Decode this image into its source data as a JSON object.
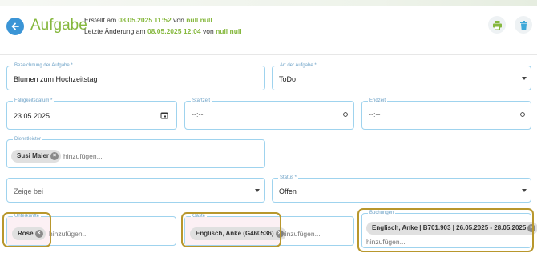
{
  "header": {
    "title": "Aufgabe",
    "created_label": "Erstellt am",
    "created_date": "08.05.2025 11:52",
    "created_by_label": "von",
    "created_by": "null null",
    "changed_label": "Letzte Änderung am",
    "changed_date": "08.05.2025 12:04",
    "changed_by_label": "von",
    "changed_by": "null null",
    "icons": {
      "back": "arrow-left-icon",
      "print": "printer-icon",
      "delete": "trash-icon"
    }
  },
  "form": {
    "bezeichnung": {
      "label": "Bezeichnung der Aufgabe *",
      "value": "Blumen zum Hochzeitstag"
    },
    "art": {
      "label": "Art der Aufgabe *",
      "value": "ToDo"
    },
    "faelligkeit": {
      "label": "Fälligkeitsdatum *",
      "value": "23.05.2025"
    },
    "startzeit": {
      "label": "Startzeit",
      "value": "--:--"
    },
    "endzeit": {
      "label": "Endzeit",
      "value": "--:--"
    },
    "dienstleister": {
      "label": "Dienstleister",
      "chip": "Susi Maier",
      "add": "hinzufügen..."
    },
    "zeige_bei": {
      "value": "Zeige bei"
    },
    "status": {
      "label": "Status *",
      "value": "Offen"
    },
    "unterkuenfte": {
      "label": "Unterkünfte",
      "chip": "Rose",
      "add": "hinzufügen..."
    },
    "gaeste": {
      "label": "Gäste",
      "chip": "Englisch, Anke (G460536)",
      "add": "hinzufügen..."
    },
    "buchungen": {
      "label": "Buchungen",
      "chip": "Englisch, Anke | B701.903 | 26.05.2025 - 28.05.2025",
      "add": "hinzufügen..."
    }
  },
  "colors": {
    "accent_green": "#86b83e",
    "accent_blue": "#3b95d6",
    "field_border": "#9fd3ee",
    "highlight": "#b8972d"
  }
}
